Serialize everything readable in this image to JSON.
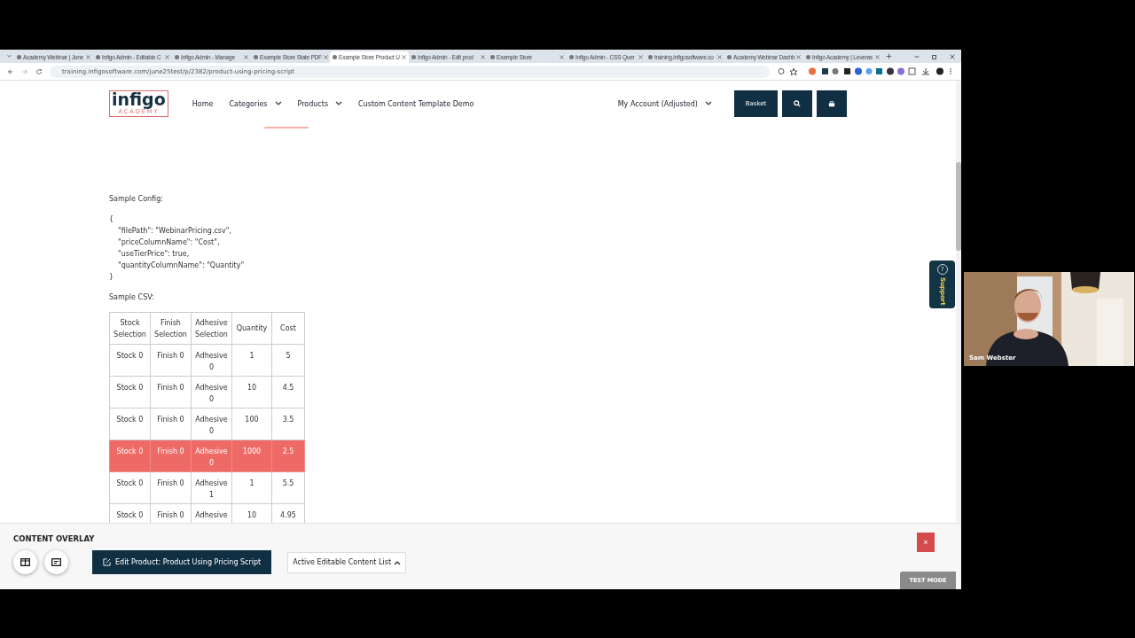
{
  "browser": {
    "tabs": [
      {
        "title": "Academy Webinar | June",
        "selected": false
      },
      {
        "title": "Infigo Admin - Editable C",
        "selected": false
      },
      {
        "title": "Infigo Admin - Manage",
        "selected": false
      },
      {
        "title": "Example Store State PDF",
        "selected": false
      },
      {
        "title": "Example Store Product U",
        "selected": true
      },
      {
        "title": "Infigo Admin - Edit prod",
        "selected": false
      },
      {
        "title": "Example Store",
        "selected": false
      },
      {
        "title": "Infigo Admin - CSS Quer",
        "selected": false
      },
      {
        "title": "training.infigosoftware.co",
        "selected": false
      },
      {
        "title": "Academy Webinar Dashb",
        "selected": false
      },
      {
        "title": "Infigo Academy | Leveras",
        "selected": false
      }
    ],
    "url": "training.infigosoftware.com/june25test/p/2382/product-using-pricing-script"
  },
  "site": {
    "logo": {
      "name": "infigo",
      "tagline": "ACADEMY"
    },
    "nav": [
      {
        "label": "Home",
        "dropdown": false
      },
      {
        "label": "Categories",
        "dropdown": true
      },
      {
        "label": "Products",
        "dropdown": true
      },
      {
        "label": "Custom Content Template Demo",
        "dropdown": false
      }
    ],
    "account": "My Account (Adjusted)",
    "basket": "Basket"
  },
  "content": {
    "config_label": "Sample Config:",
    "config_open": "{",
    "config_entries": [
      "\"filePath\": \"WebinarPricing.csv\",",
      "\"priceColumnName\": \"Cost\",",
      "\"useTierPrice\": true,",
      "\"quantityColumnName\": \"Quantity\""
    ],
    "config_close": "}",
    "csv_label": "Sample CSV:",
    "table": {
      "columns": [
        "Stock Selection",
        "Finish Selection",
        "Adhesive Selection",
        "Quantity",
        "Cost"
      ],
      "rows": [
        {
          "cells": [
            "Stock 0",
            "Finish 0",
            "Adhesive 0",
            "1",
            "5"
          ],
          "selected": false
        },
        {
          "cells": [
            "Stock 0",
            "Finish 0",
            "Adhesive 0",
            "10",
            "4.5"
          ],
          "selected": false
        },
        {
          "cells": [
            "Stock 0",
            "Finish 0",
            "Adhesive 0",
            "100",
            "3.5"
          ],
          "selected": false
        },
        {
          "cells": [
            "Stock 0",
            "Finish 0",
            "Adhesive 0",
            "1000",
            "2.5"
          ],
          "selected": true
        },
        {
          "cells": [
            "Stock 0",
            "Finish 0",
            "Adhesive 1",
            "1",
            "5.5"
          ],
          "selected": false
        },
        {
          "cells": [
            "Stock 0",
            "Finish 0",
            "Adhesive",
            "10",
            "4.95"
          ],
          "selected": false
        }
      ]
    }
  },
  "support": {
    "icon": "?",
    "label": "Support"
  },
  "overlay": {
    "title": "CONTENT OVERLAY",
    "edit_button": "Edit Product: Product Using Pricing Script",
    "list_button": "Active Editable Content List",
    "close": "×",
    "badge": "TEST MODE"
  },
  "video": {
    "name": "Sam Webster"
  }
}
